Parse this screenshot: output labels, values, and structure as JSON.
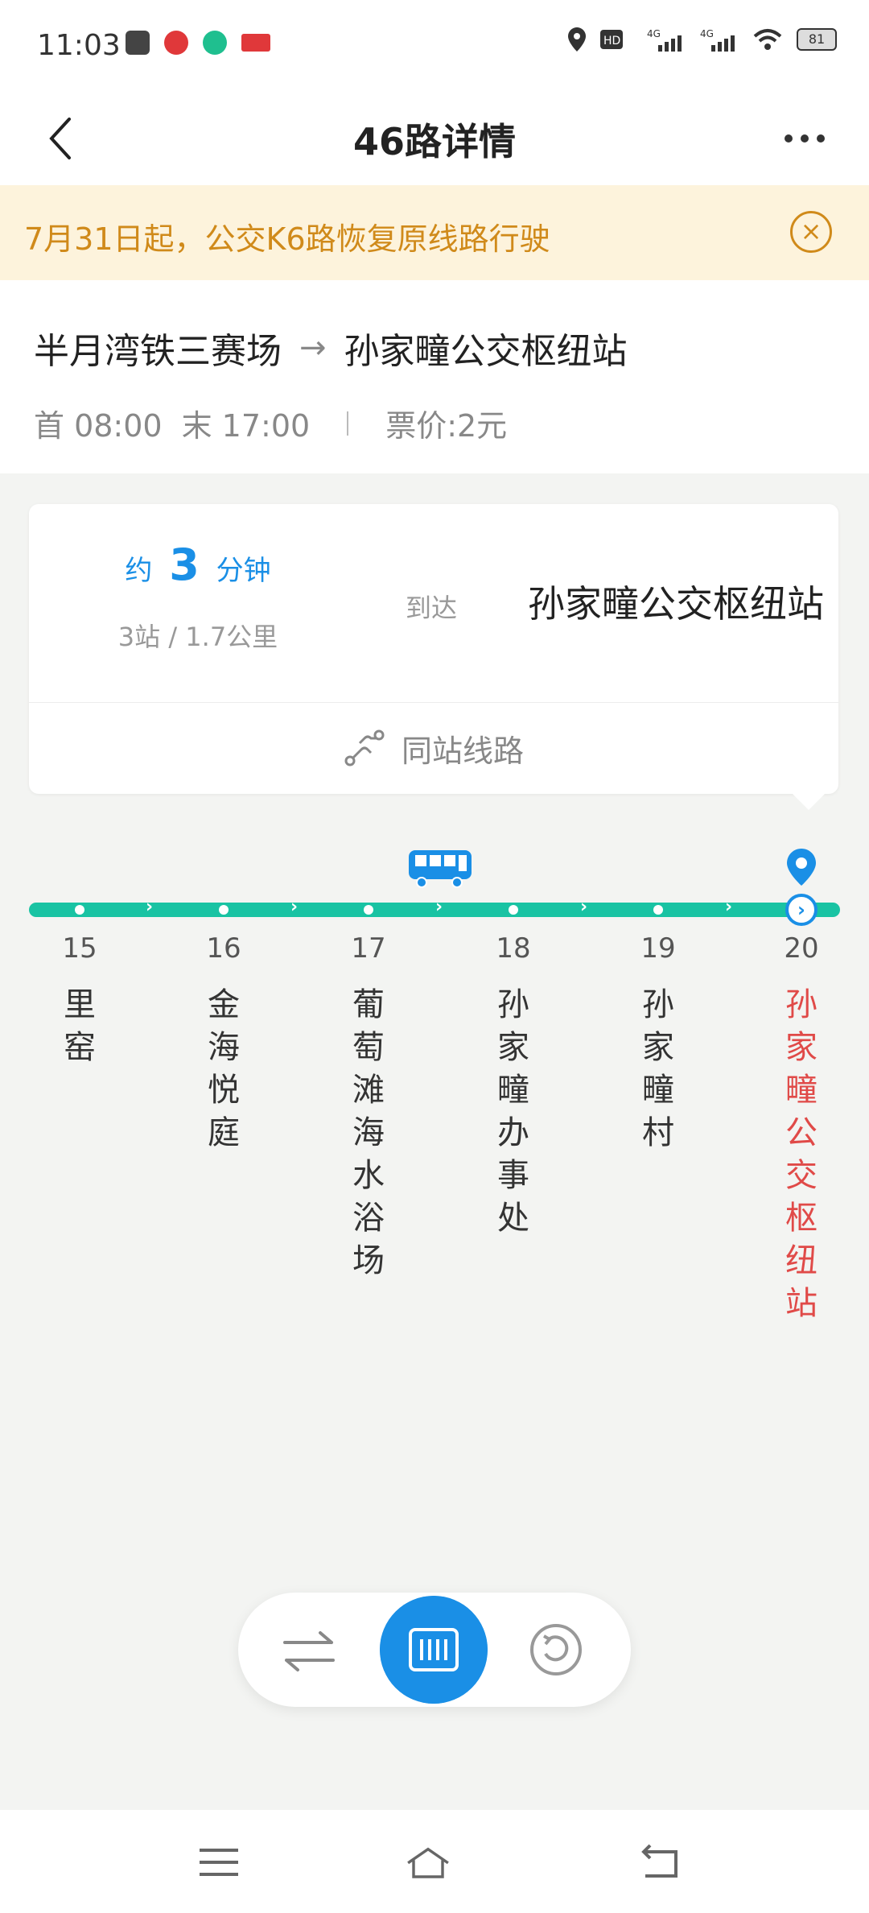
{
  "status_bar": {
    "time": "11:03",
    "icons": [
      "calendar-icon",
      "app-red-icon",
      "app-green-icon",
      "toutiao-icon"
    ],
    "right_icons": [
      "location-icon",
      "hd-icon",
      "signal-4g-icon",
      "signal-4g-icon",
      "wifi-icon"
    ],
    "battery": "81"
  },
  "header": {
    "title": "46路详情"
  },
  "notice": {
    "text": "7月31日起，公交K6路恢复原线路行驶"
  },
  "route": {
    "from": "半月湾铁三赛场",
    "arrow": "→",
    "to": "孙家疃公交枢纽站",
    "first": "首 08:00",
    "last": "末 17:00",
    "fare": "票价:2元"
  },
  "eta": {
    "prefix": "约",
    "minutes": "3",
    "suffix": "分钟",
    "sub": "3站 / 1.7公里",
    "arrive_label": "到达",
    "arrive_station": "孙家疃公交枢纽站",
    "same_lines": "同站线路"
  },
  "stations": [
    {
      "num": "15",
      "name": "里窑"
    },
    {
      "num": "16",
      "name": "金海悦庭"
    },
    {
      "num": "17",
      "name": "葡萄滩海水浴场"
    },
    {
      "num": "18",
      "name": "孙家疃办事处"
    },
    {
      "num": "19",
      "name": "孙家疃村"
    },
    {
      "num": "20",
      "name": "孙家疃公交枢纽站"
    }
  ],
  "colors": {
    "accent": "#1a8fe6",
    "track": "#19c3a3",
    "notice_text": "#d08a1a",
    "notice_bg": "#fdf3dc",
    "active_station": "#e04a48"
  }
}
